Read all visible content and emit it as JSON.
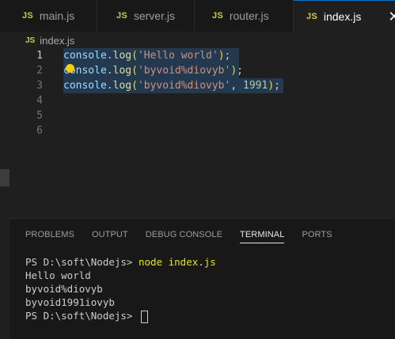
{
  "tabs": [
    {
      "icon": "JS",
      "label": "main.js"
    },
    {
      "icon": "JS",
      "label": "server.js"
    },
    {
      "icon": "JS",
      "label": "router.js"
    },
    {
      "icon": "JS",
      "label": "index.js",
      "active": true
    }
  ],
  "breadcrumb": {
    "icon": "JS",
    "file": "index.js"
  },
  "editor": {
    "line_numbers": [
      "1",
      "2",
      "3",
      "4",
      "5",
      "6"
    ],
    "lines": [
      {
        "obj": "console",
        "dot": ".",
        "fn": "log",
        "open": "(",
        "str": "'Hello world'",
        "comma": "",
        "num": "",
        "close": ")",
        "semi": ";"
      },
      {
        "obj": "console",
        "dot": ".",
        "fn": "log",
        "open": "(",
        "str": "'byvoid%diovyb'",
        "comma": "",
        "num": "",
        "close": ")",
        "semi": ";"
      },
      {
        "obj": "console",
        "dot": ".",
        "fn": "log",
        "open": "(",
        "str": "'byvoid%diovyb'",
        "comma": ", ",
        "num": "1991",
        "close": ")",
        "semi": ";"
      }
    ]
  },
  "panel": {
    "tabs": [
      "PROBLEMS",
      "OUTPUT",
      "DEBUG CONSOLE",
      "TERMINAL",
      "PORTS"
    ],
    "active_tab": "TERMINAL"
  },
  "terminal": {
    "prompt1": "PS D:\\soft\\Nodejs> ",
    "command": "node index.js",
    "output": [
      "Hello world",
      "byvoid%diovyb",
      "byvoid1991iovyb"
    ],
    "prompt2": "PS D:\\soft\\Nodejs> "
  }
}
